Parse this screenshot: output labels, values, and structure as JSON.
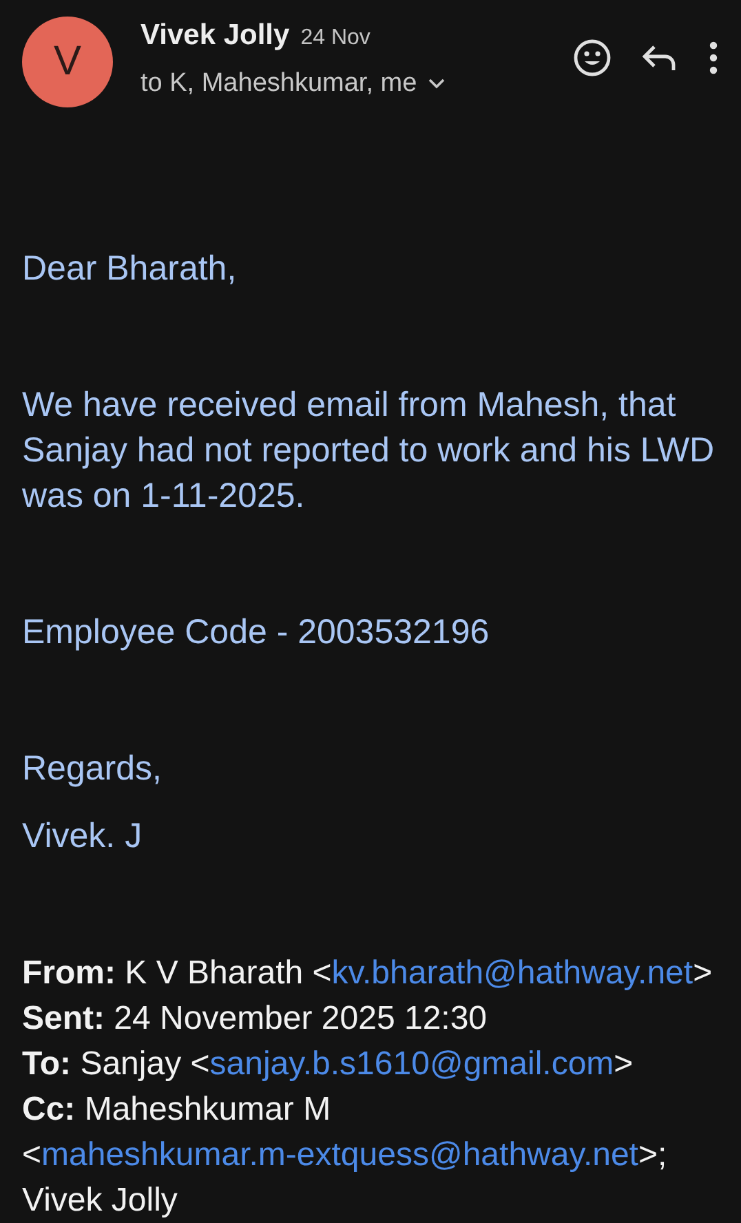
{
  "message_header": {
    "avatar_letter": "V",
    "sender": "Vivek Jolly",
    "date": "24 Nov",
    "recipients": "to K, Maheshkumar, me"
  },
  "body": [
    "Dear Bharath,",
    "We have received email from Mahesh, that Sanjay had not reported to work and his LWD was on  1-11-2025.",
    "Employee Code - 2003532196"
  ],
  "signature": {
    "closing": "Regards,",
    "name": "Vivek. J"
  },
  "quoted_header": [
    {
      "label": "From:",
      "parts": [
        {
          "kind": "text",
          "text": "K V Bharath <"
        },
        {
          "kind": "link",
          "text": "kv.bharath@hathway.net"
        },
        {
          "kind": "text",
          "text": ">"
        }
      ]
    },
    {
      "label": "Sent:",
      "parts": [
        {
          "kind": "text",
          "text": "24 November 2025 12:30"
        }
      ]
    },
    {
      "label": "To:",
      "parts": [
        {
          "kind": "text",
          "text": "Sanjay <"
        },
        {
          "kind": "link",
          "text": "sanjay.b.s1610@gmail.com"
        },
        {
          "kind": "text",
          "text": ">"
        }
      ]
    },
    {
      "label": "Cc:",
      "parts": [
        {
          "kind": "text",
          "text": "Maheshkumar M <"
        },
        {
          "kind": "link",
          "text": "maheshkumar.m-extquess@hathway.net"
        },
        {
          "kind": "text",
          "text": ">; Vivek Jolly"
        }
      ]
    }
  ]
}
